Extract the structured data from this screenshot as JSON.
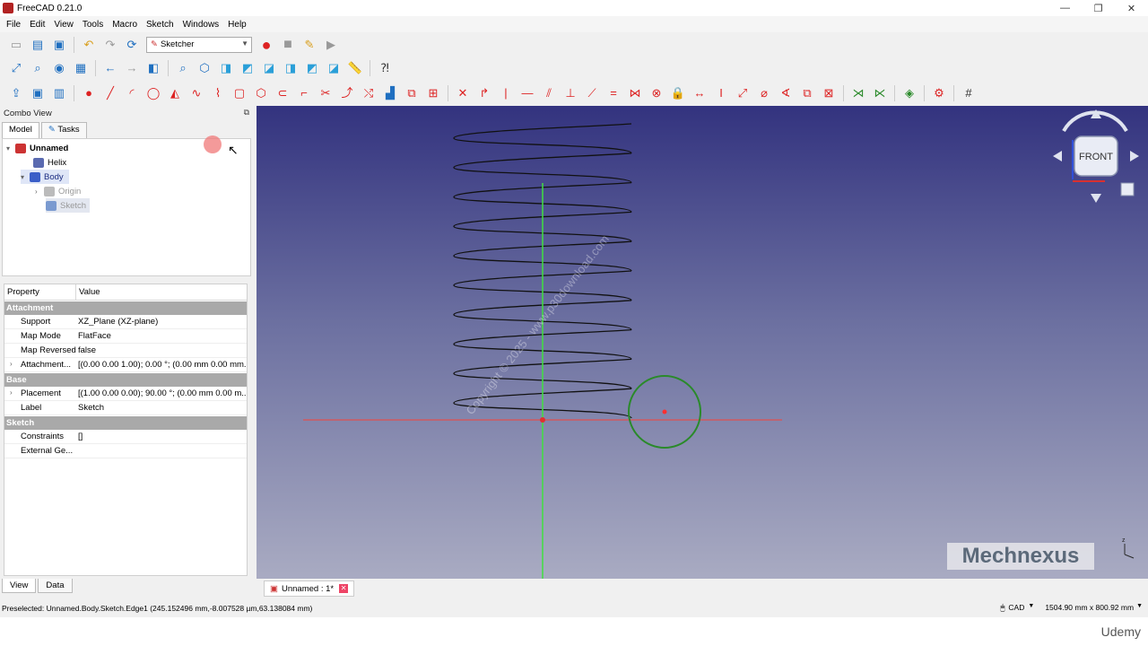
{
  "window": {
    "title": "FreeCAD 0.21.0",
    "controls": {
      "minimize": "—",
      "restore": "❐",
      "close": "✕"
    }
  },
  "menu": [
    "File",
    "Edit",
    "View",
    "Tools",
    "Macro",
    "Sketch",
    "Windows",
    "Help"
  ],
  "toolbar": {
    "workbench": "Sketcher"
  },
  "combo_view": {
    "title": "Combo View",
    "tabs": [
      "Model",
      "Tasks"
    ],
    "tree": [
      {
        "label": "Unnamed",
        "level": 0,
        "expanded": true
      },
      {
        "label": "Helix",
        "level": 1
      },
      {
        "label": "Body",
        "level": 1,
        "expanded": true,
        "selected": true
      },
      {
        "label": "Origin",
        "level": 2,
        "dim": true
      },
      {
        "label": "Sketch",
        "level": 2,
        "dim": true,
        "selected": true
      }
    ],
    "property_header": {
      "col1": "Property",
      "col2": "Value"
    },
    "groups": [
      {
        "name": "Attachment",
        "rows": [
          {
            "key": "Support",
            "value": "XZ_Plane (XZ-plane)"
          },
          {
            "key": "Map Mode",
            "value": "FlatFace"
          },
          {
            "key": "Map Reversed",
            "value": "false"
          },
          {
            "key": "Attachment...",
            "value": "[(0.00 0.00 1.00); 0.00 °; (0.00 mm  0.00 mm...",
            "expandable": true
          }
        ]
      },
      {
        "name": "Base",
        "rows": [
          {
            "key": "Placement",
            "value": "[(1.00 0.00 0.00); 90.00 °; (0.00 mm  0.00 m...",
            "expandable": true
          },
          {
            "key": "Label",
            "value": "Sketch"
          }
        ]
      },
      {
        "name": "Sketch",
        "rows": [
          {
            "key": "Constraints",
            "value": "[]"
          },
          {
            "key": "External Ge...",
            "value": ""
          }
        ]
      }
    ],
    "bottom_tabs": [
      "View",
      "Data"
    ]
  },
  "viewport": {
    "navcube_face": "FRONT",
    "watermark": "Copyright © 2025 - www.p30download.com",
    "logo": "Mechnexus",
    "colors": {
      "bg_top": "#33337f",
      "bg_bottom": "#a9abc2",
      "x_axis": "#e05050",
      "y_axis": "#40e040",
      "circle": "#2a8a2a",
      "helix": "#111111"
    }
  },
  "doc_tab": "Unnamed : 1*",
  "status": {
    "message": "Preselected: Unnamed.Body.Sketch.Edge1 (245.152496 mm,-8.007528 µm,63.138084 mm)",
    "nav_style": "CAD",
    "dimensions": "1504.90 mm x 800.92 mm"
  },
  "branding": "Udemy"
}
